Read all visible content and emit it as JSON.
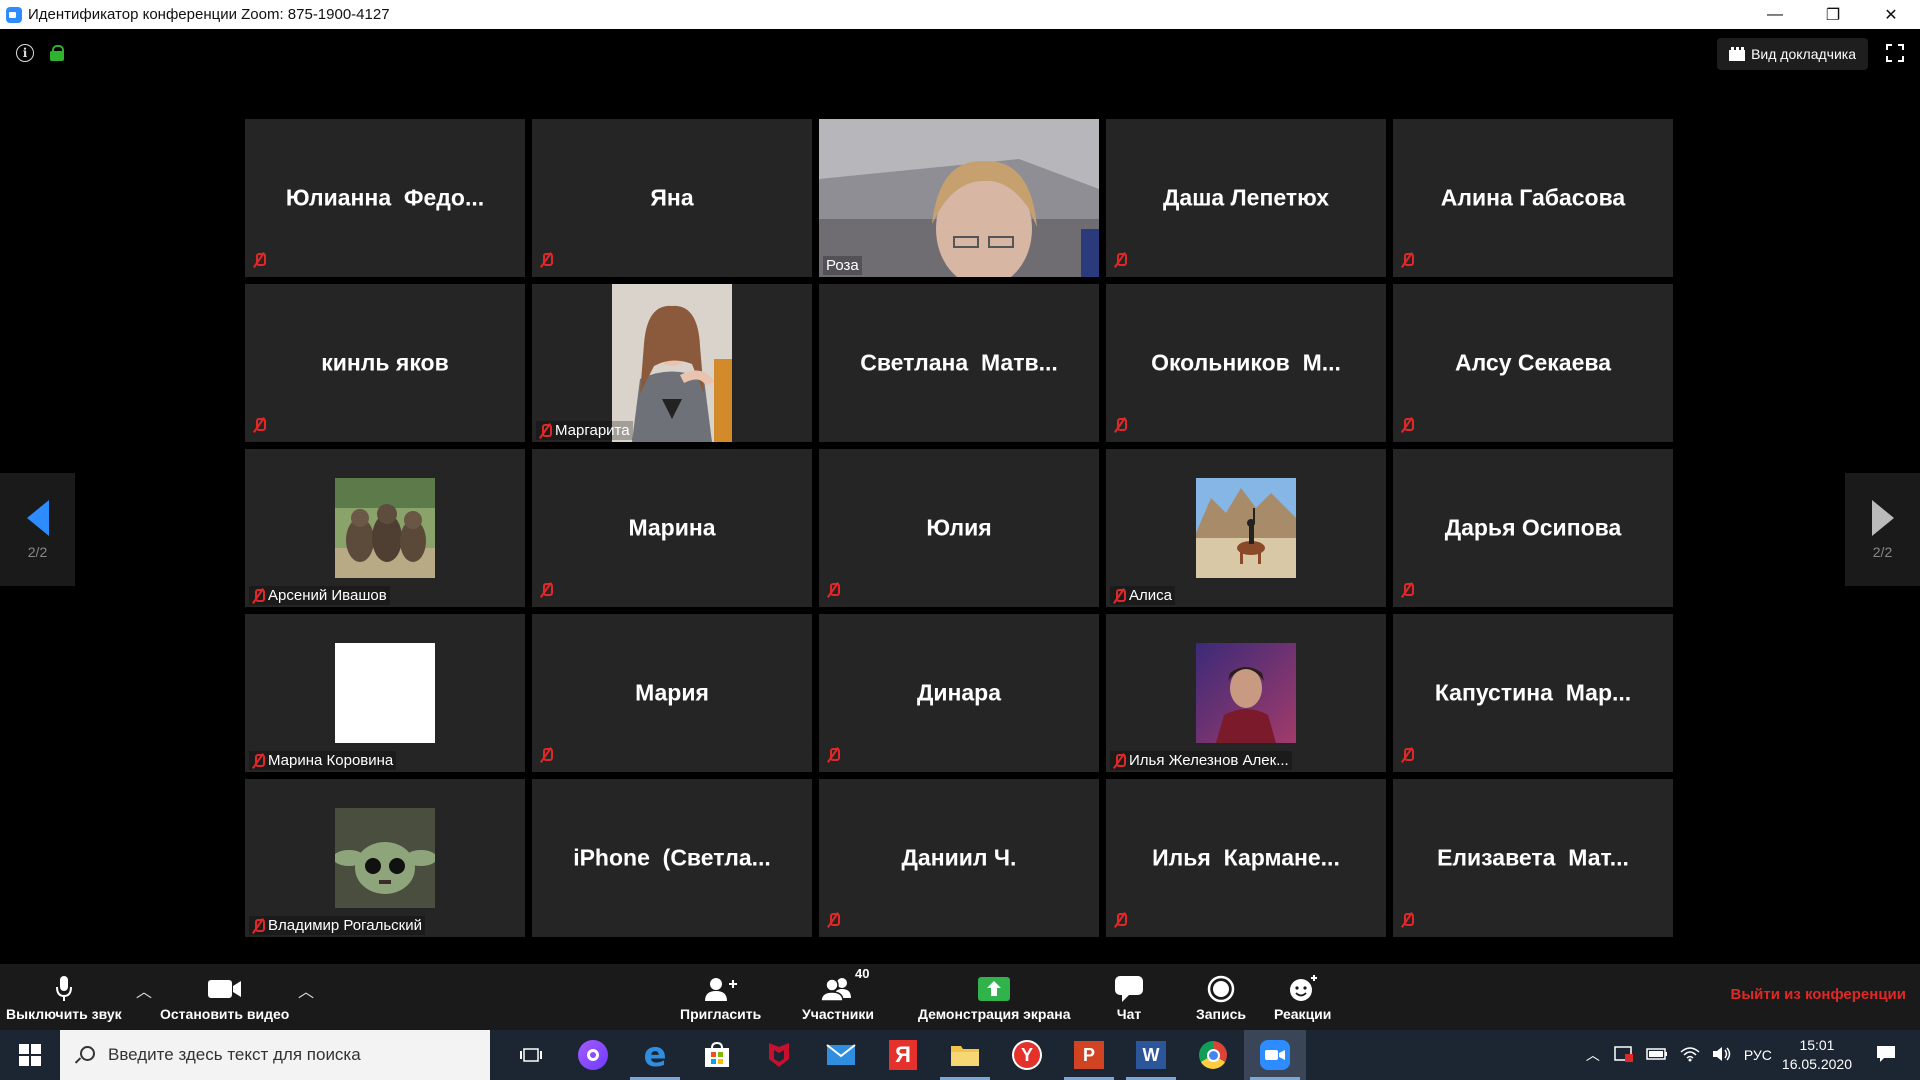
{
  "window": {
    "title": "Идентификатор конференции Zoom: 875-1900-4127",
    "controls": [
      "—",
      "❐",
      "✕"
    ]
  },
  "top_bar": {
    "speaker_view_label": "Вид докладчика"
  },
  "pagination": {
    "left_label": "2/2",
    "right_label": "2/2"
  },
  "tiles": [
    {
      "display": "name",
      "name": "Юлианна  Федо...",
      "muted": true
    },
    {
      "display": "name",
      "name": "Яна",
      "muted": true
    },
    {
      "display": "video",
      "name": "Роза",
      "muted": false,
      "label": "Роза"
    },
    {
      "display": "name",
      "name": "Даша Лепетюх",
      "muted": true
    },
    {
      "display": "name",
      "name": "Алина Габасова",
      "muted": true
    },
    {
      "display": "name",
      "name": "кинль яков",
      "muted": true
    },
    {
      "display": "video",
      "name": "Маргарита",
      "muted": true,
      "label": "Маргарита"
    },
    {
      "display": "name",
      "name": "Светлана  Матв...",
      "muted": false
    },
    {
      "display": "name",
      "name": "Окольников  М...",
      "muted": true
    },
    {
      "display": "name",
      "name": "Алсу Секаева",
      "muted": true
    },
    {
      "display": "avatar",
      "name": "Арсений Ивашов",
      "muted": true,
      "label": "Арсений Ивашов",
      "avatar": "seals"
    },
    {
      "display": "name",
      "name": "Марина",
      "muted": true
    },
    {
      "display": "name",
      "name": "Юлия",
      "muted": true
    },
    {
      "display": "avatar",
      "name": "Алиса",
      "muted": true,
      "label": "Алиса",
      "avatar": "horse-rider"
    },
    {
      "display": "name",
      "name": "Дарья Осипова",
      "muted": true
    },
    {
      "display": "avatar",
      "name": "Марина Коровина",
      "muted": true,
      "label": "Марина Коровина",
      "avatar": "blank-white"
    },
    {
      "display": "name",
      "name": "Мария",
      "muted": true
    },
    {
      "display": "name",
      "name": "Динара",
      "muted": true
    },
    {
      "display": "avatar",
      "name": "Илья Железнов Алек...",
      "muted": true,
      "label": "Илья Железнов Алек...",
      "avatar": "portrait-purple"
    },
    {
      "display": "name",
      "name": "Капустина  Мар...",
      "muted": true
    },
    {
      "display": "avatar",
      "name": "Владимир Рогальский",
      "muted": true,
      "label": "Владимир Рогальский",
      "avatar": "baby-yoda"
    },
    {
      "display": "name",
      "name": "iPhone  (Светла...",
      "muted": false
    },
    {
      "display": "name",
      "name": "Даниил Ч.",
      "muted": true
    },
    {
      "display": "name",
      "name": "Илья  Карманe...",
      "muted": true
    },
    {
      "display": "name",
      "name": "Елизавета  Мат...",
      "muted": true
    }
  ],
  "toolbar": {
    "mute_label": "Выключить звук",
    "video_label": "Остановить видео",
    "invite_label": "Пригласить",
    "participants_label": "Участники",
    "participants_count": "40",
    "share_label": "Демонстрация экрана",
    "chat_label": "Чат",
    "record_label": "Запись",
    "reactions_label": "Реакции",
    "leave_label": "Выйти из конференции"
  },
  "taskbar": {
    "search_placeholder": "Введите здесь текст для поиска",
    "language": "РУС",
    "time": "15:01",
    "date": "16.05.2020",
    "apps": [
      "task-view-icon",
      "alice-icon",
      "edge-icon",
      "store-icon",
      "mcafee-icon",
      "mail-icon",
      "yandex-icon",
      "explorer-icon",
      "yandex-browser-icon",
      "powerpoint-icon",
      "word-icon",
      "chrome-icon",
      "zoom-icon"
    ]
  },
  "colors": {
    "accent": "#2d8cff",
    "tile_bg": "#252525",
    "muted_red": "#e02828",
    "leave_red": "#e02828"
  }
}
